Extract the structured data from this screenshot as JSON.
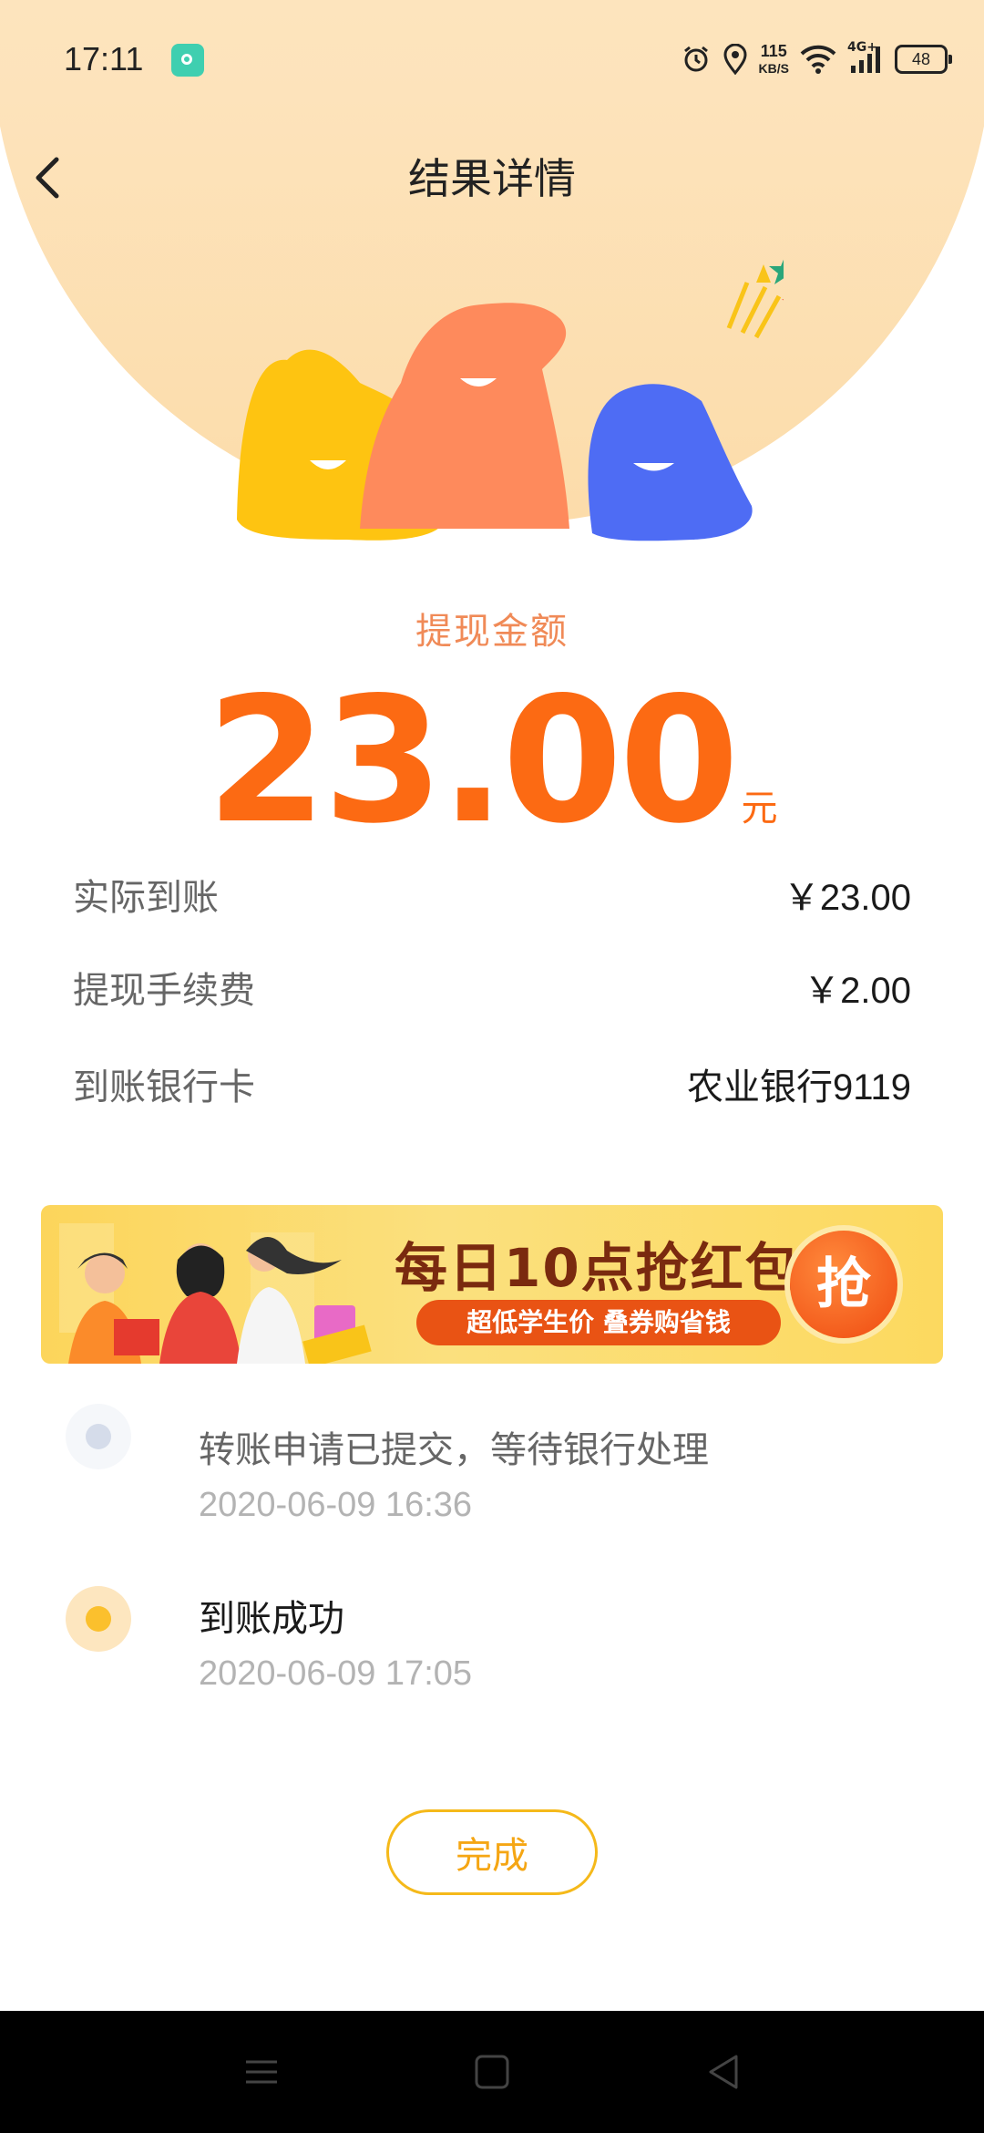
{
  "status_bar": {
    "time": "17:11",
    "net_speed_value": "115",
    "net_speed_unit": "KB/S",
    "network_type": "4G+",
    "battery": "48",
    "icons": [
      "alarm-icon",
      "location-icon",
      "wifi-icon",
      "signal-icon",
      "battery-icon"
    ]
  },
  "header": {
    "title": "结果详情",
    "back_icon": "chevron-left-icon"
  },
  "amount": {
    "label": "提现金额",
    "value": "23.00",
    "unit": "元"
  },
  "details": [
    {
      "label": "实际到账",
      "value": "￥23.00"
    },
    {
      "label": "提现手续费",
      "value": "￥2.00"
    },
    {
      "label": "到账银行卡",
      "value": "农业银行9119"
    }
  ],
  "banner": {
    "title": "每日10点抢红包",
    "subtitle": "超低学生价 叠券购省钱",
    "button": "抢"
  },
  "timeline": [
    {
      "title": "转账申请已提交，等待银行处理",
      "time": "2020-06-09 16:36",
      "state": "done"
    },
    {
      "title": "到账成功",
      "time": "2020-06-09 17:05",
      "state": "current"
    }
  ],
  "done_button": "完成",
  "colors": {
    "accent_orange": "#fc6a13",
    "label_orange": "#f08a57",
    "button_gold": "#f5b91a",
    "header_bg": "#fde5bf"
  }
}
